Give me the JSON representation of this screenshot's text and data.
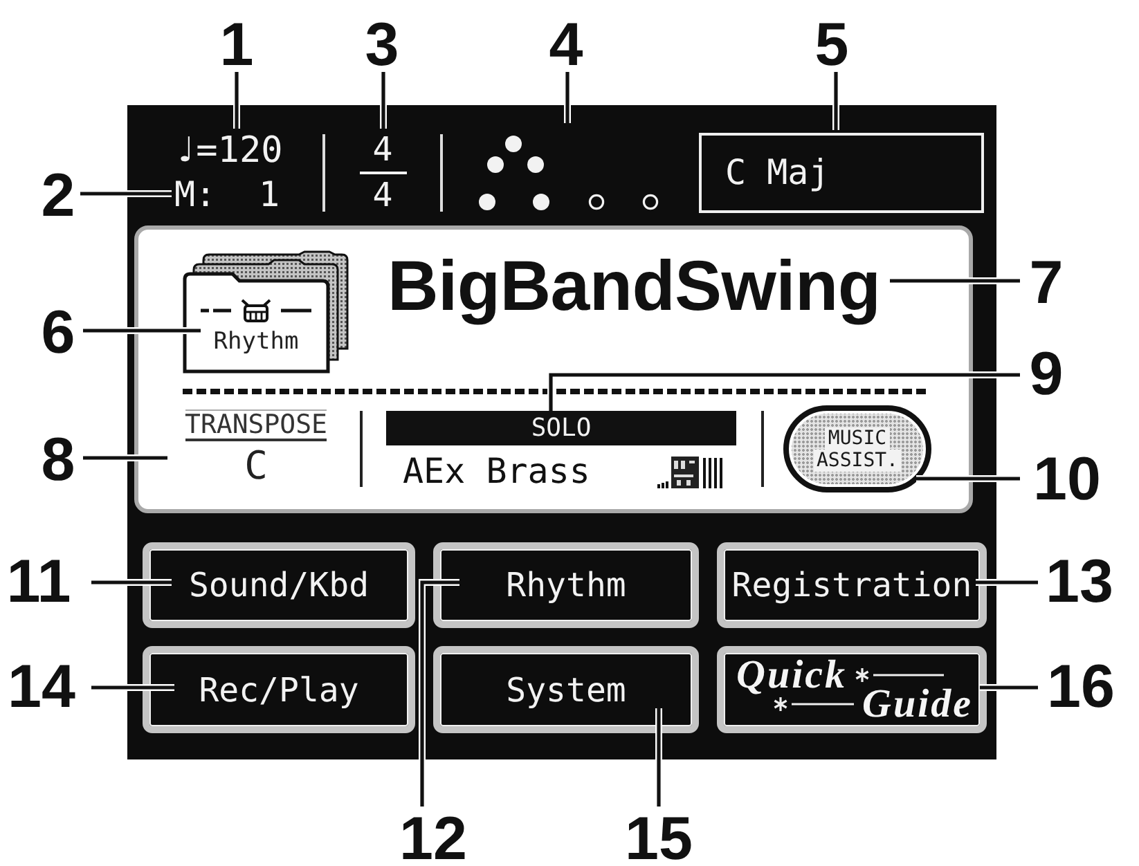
{
  "callouts": [
    "1",
    "2",
    "3",
    "4",
    "5",
    "6",
    "7",
    "8",
    "9",
    "10",
    "11",
    "12",
    "13",
    "14",
    "15",
    "16"
  ],
  "status_bar": {
    "tempo": "♩=120",
    "measure_label": "M:",
    "measure": "1",
    "time_signature": {
      "numerator": "4",
      "denominator": "4"
    },
    "beat_indicator": [
      {
        "lit": true
      },
      {
        "lit": true
      },
      {
        "lit": true
      },
      {
        "lit": true
      },
      {
        "lit": true
      },
      {
        "lit": false
      },
      {
        "lit": false
      }
    ],
    "key": "C Maj"
  },
  "rhythm_panel": {
    "category": "Rhythm",
    "rhythm_name": "BigBandSwing",
    "transpose": {
      "label": "TRANSPOSE",
      "value": "C"
    },
    "part": {
      "mode": "SOLO",
      "tone": "AEx Brass"
    },
    "music_assist_button": {
      "lines": [
        "MUSIC",
        "ASSIST."
      ]
    }
  },
  "menu_buttons": [
    {
      "kind": "text",
      "label": "Sound/Kbd"
    },
    {
      "kind": "text",
      "label": "Rhythm"
    },
    {
      "kind": "text",
      "label": "Registration"
    },
    {
      "kind": "text",
      "label": "Rec/Play"
    },
    {
      "kind": "text",
      "label": "System"
    },
    {
      "kind": "logo",
      "lines": [
        "Quick",
        "Guide"
      ]
    }
  ]
}
